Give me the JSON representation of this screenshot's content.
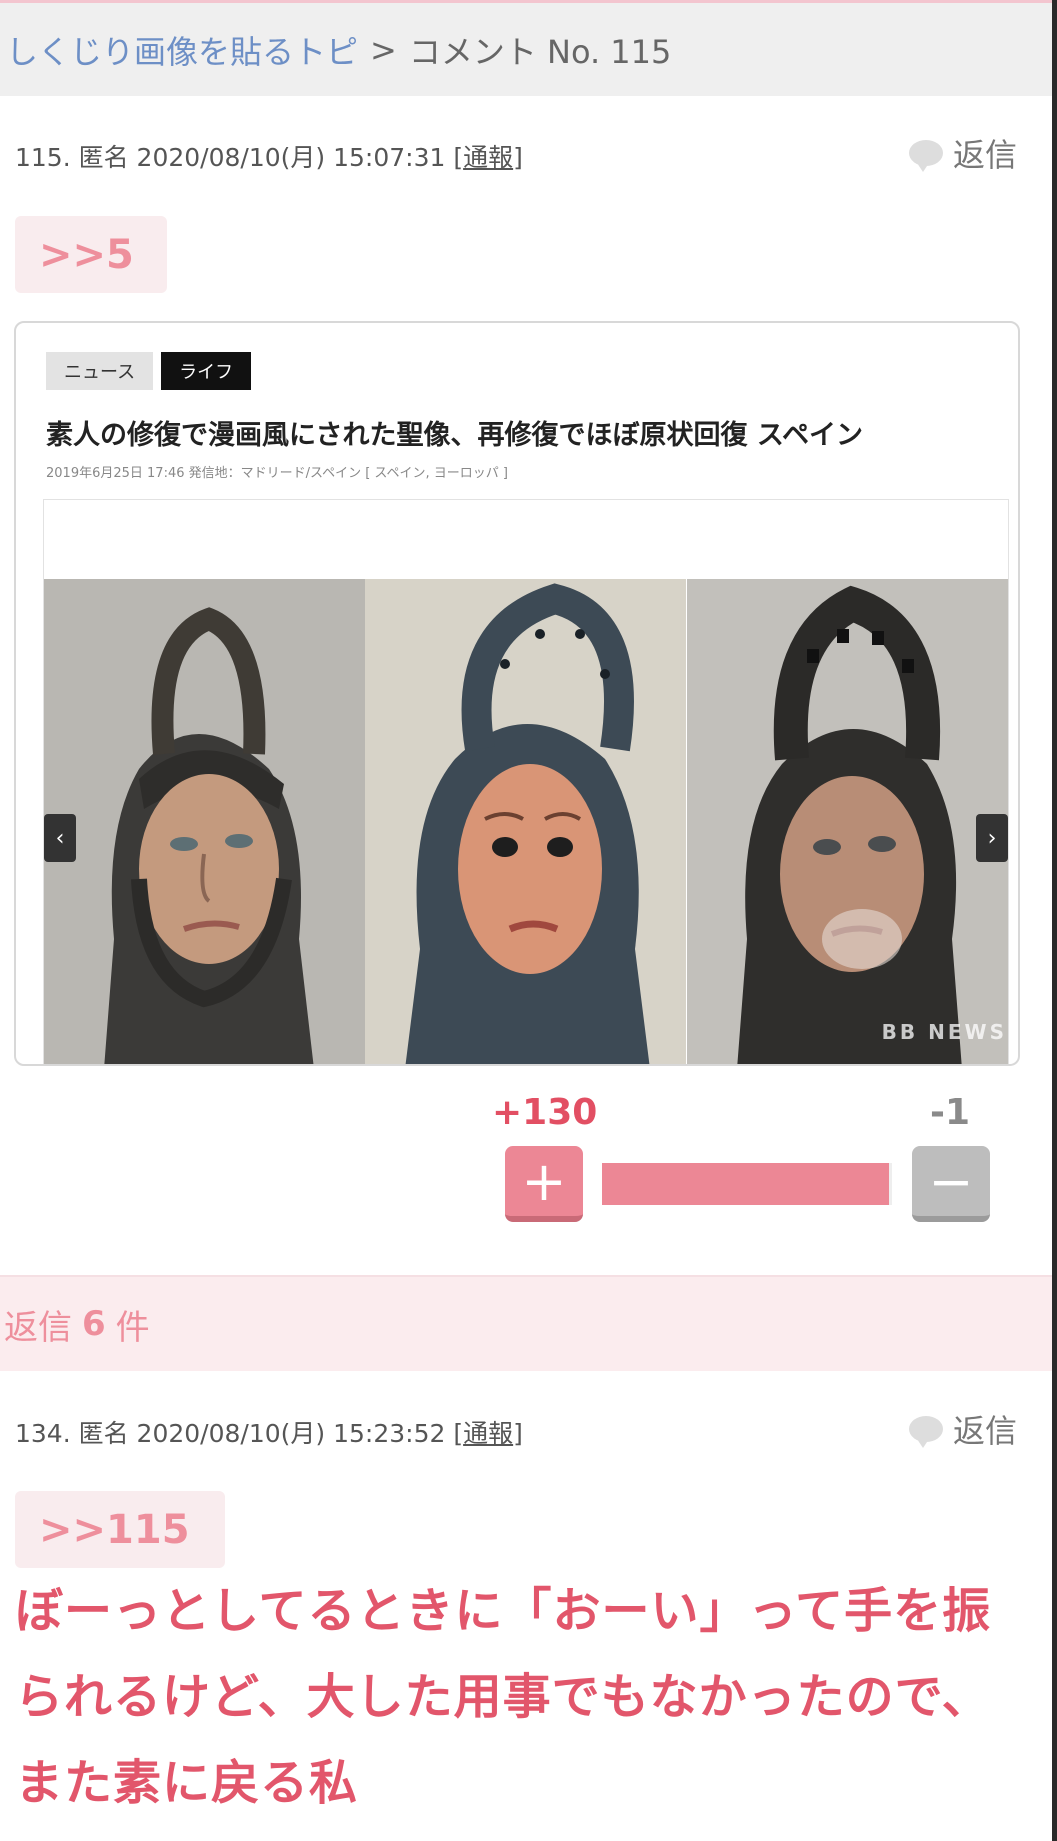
{
  "breadcrumb": {
    "topic_link": "しくじり画像を貼るトピ",
    "separator": ">",
    "current": "コメント No. 115"
  },
  "comment_115": {
    "meta": "115. 匿名 2020/08/10(月) 15:07:31",
    "report_open": "[",
    "report": "通報",
    "report_close": "]",
    "reply_label": "返信",
    "anchor": ">>5",
    "article": {
      "tag_news": "ニュース",
      "tag_life": "ライフ",
      "headline": "素人の修復で漫画風にされた聖像、再修復でほぼ原状回復 スペイン",
      "byline": "2019年6月25日 17:46 発信地：マドリード/スペイン [ スペイン, ヨーロッパ ]",
      "watermark": "BB NEWS",
      "prev_icon": "chevron-left-icon",
      "next_icon": "chevron-right-icon"
    },
    "votes": {
      "plus_count": "+130",
      "minus_count": "-1",
      "plus_symbol": "+",
      "minus_symbol": "−",
      "plus_ratio": 0.99
    }
  },
  "replies_header": {
    "label_prefix": "返信",
    "count": "6",
    "label_suffix": "件"
  },
  "comment_134": {
    "meta": "134. 匿名 2020/08/10(月) 15:23:52",
    "report_open": "[",
    "report": "通報",
    "report_close": "]",
    "reply_label": "返信",
    "anchor": ">>115",
    "body": "ぼーっとしてるときに「おーい」って手を振られるけど、大した用事でもなかったので、また素に戻る私"
  },
  "colors": {
    "accent_pink": "#ec8795",
    "link_blue": "#6d8fc6",
    "body_red": "#e2566b"
  }
}
